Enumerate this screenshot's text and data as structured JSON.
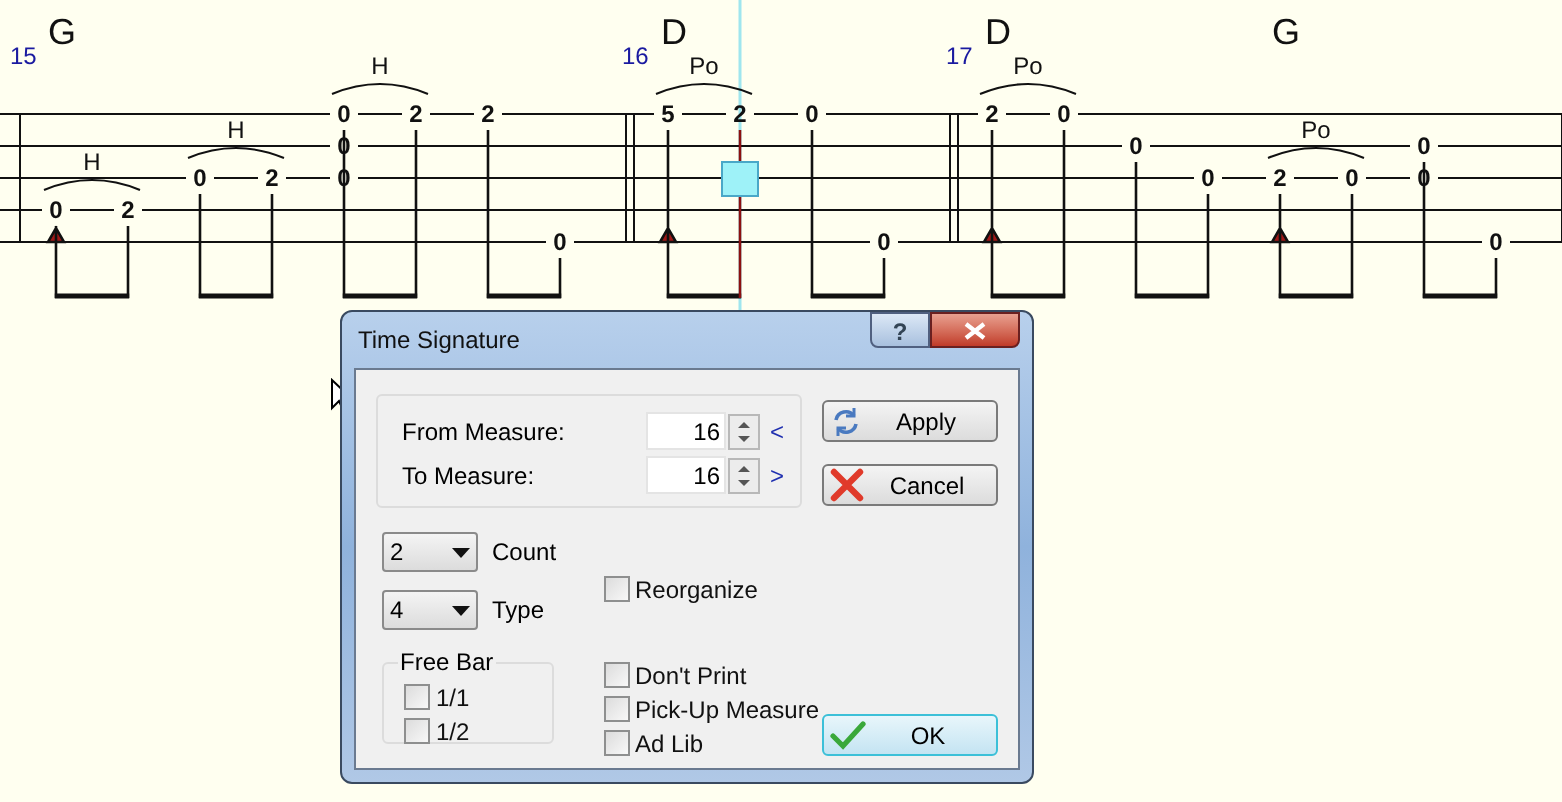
{
  "tab": {
    "measures": [
      {
        "number": "15",
        "beats": [
          {
            "cells": [
              null,
              null,
              null,
              "0",
              null
            ],
            "accent": true,
            "selected": false,
            "slur": "H",
            "chord": "G"
          },
          {
            "cells": [
              null,
              null,
              null,
              "2",
              null
            ],
            "accent": false,
            "selected": false
          },
          {
            "cells": [
              null,
              null,
              "0",
              null,
              null
            ],
            "accent": false,
            "selected": false,
            "slur": "H"
          },
          {
            "cells": [
              null,
              null,
              "2",
              null,
              null
            ],
            "accent": false,
            "selected": false
          },
          {
            "cells": [
              "0",
              "0",
              "0",
              null,
              null
            ],
            "accent": false,
            "selected": false,
            "slur": "H"
          },
          {
            "cells": [
              "2",
              null,
              null,
              null,
              null
            ],
            "accent": false,
            "selected": false
          },
          {
            "cells": [
              "2",
              null,
              null,
              null,
              null
            ],
            "accent": false,
            "selected": false
          },
          {
            "cells": [
              null,
              null,
              null,
              null,
              "0"
            ],
            "accent": false,
            "selected": false
          }
        ]
      },
      {
        "number": "16",
        "beats": [
          {
            "cells": [
              "5",
              null,
              null,
              null,
              null
            ],
            "accent": true,
            "selected": false,
            "slur": "Po",
            "chord": "D"
          },
          {
            "cells": [
              "2",
              null,
              {
                "cursor": true
              },
              null,
              null
            ],
            "accent": false,
            "selected": true
          },
          {
            "cells": [
              "0",
              null,
              null,
              null,
              null
            ],
            "accent": false,
            "selected": false
          },
          {
            "cells": [
              null,
              null,
              null,
              null,
              "0"
            ],
            "accent": false,
            "selected": false
          }
        ]
      },
      {
        "number": "17",
        "beats": [
          {
            "cells": [
              "2",
              null,
              null,
              null,
              null
            ],
            "accent": true,
            "selected": false,
            "slur": "Po",
            "chord": "D"
          },
          {
            "cells": [
              "0",
              null,
              null,
              null,
              null
            ],
            "accent": false,
            "selected": false
          },
          {
            "cells": [
              null,
              "0",
              null,
              null,
              null
            ],
            "accent": false,
            "selected": false
          },
          {
            "cells": [
              null,
              null,
              "0",
              null,
              null
            ],
            "accent": false,
            "selected": false
          },
          {
            "cells": [
              null,
              null,
              "2",
              null,
              null
            ],
            "accent": true,
            "selected": false,
            "slur": "Po",
            "chord": "G"
          },
          {
            "cells": [
              null,
              null,
              "0",
              null,
              null
            ],
            "accent": false,
            "selected": false
          },
          {
            "cells": [
              null,
              "0",
              "0",
              null,
              null
            ],
            "accent": false,
            "selected": false
          },
          {
            "cells": [
              null,
              null,
              null,
              null,
              "0"
            ],
            "accent": false,
            "selected": false
          }
        ]
      }
    ]
  },
  "dialog": {
    "title": "Time Signature",
    "help_button": "?",
    "from_measure": {
      "label": "From Measure:",
      "value": "16",
      "arrow": "<"
    },
    "to_measure": {
      "label": "To Measure:",
      "value": "16",
      "arrow": ">"
    },
    "count": {
      "value": "2",
      "label": "Count"
    },
    "type": {
      "value": "4",
      "label": "Type"
    },
    "reorganize": {
      "label": "Reorganize",
      "checked": false
    },
    "free_bar": {
      "title": "Free Bar",
      "options": [
        {
          "label": "1/1",
          "checked": false
        },
        {
          "label": "1/2",
          "checked": false
        }
      ]
    },
    "options": [
      {
        "label": "Don't Print",
        "checked": false
      },
      {
        "label": "Pick-Up Measure",
        "checked": false
      },
      {
        "label": "Ad Lib",
        "checked": false
      }
    ],
    "apply": "Apply",
    "cancel": "Cancel",
    "ok": "OK"
  }
}
